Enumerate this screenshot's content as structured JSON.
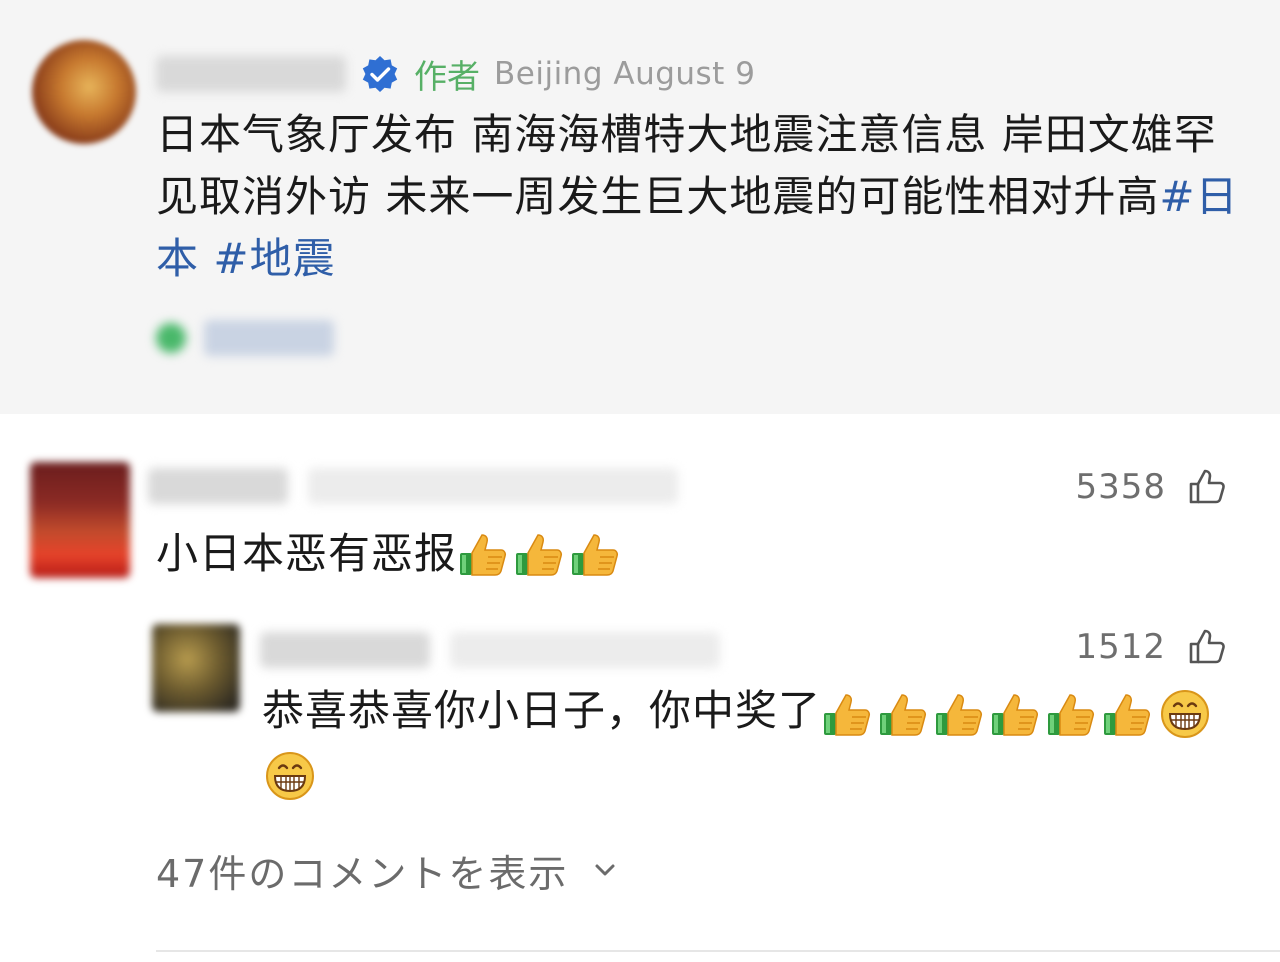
{
  "post": {
    "author_tag": "作者",
    "time": "Beijing August 9",
    "body": "日本气象厅发布 南海海槽特大地震注意信息 岸田文雄罕见取消外访 未来一周发生巨大地震的可能性相对升高",
    "hashtags": [
      "#日本",
      "#地震"
    ]
  },
  "comments": [
    {
      "likes": "5358",
      "text": "小日本恶有恶报"
    },
    {
      "likes": "1512",
      "text": "恭喜恭喜你小日子，你中奖了"
    }
  ],
  "view_more_label": "47件のコメントを表示",
  "colors": {
    "author_tag": "#57b066",
    "hashtag": "#2f5ea8",
    "verified_badge": "#2f6fd3",
    "post_background": "#f5f5f5"
  },
  "icons": [
    "verified-badge-icon",
    "location-icon",
    "thumbs-up-outline-icon",
    "thumbs-up-emoji",
    "grinning-face-emoji",
    "chevron-down-icon"
  ]
}
